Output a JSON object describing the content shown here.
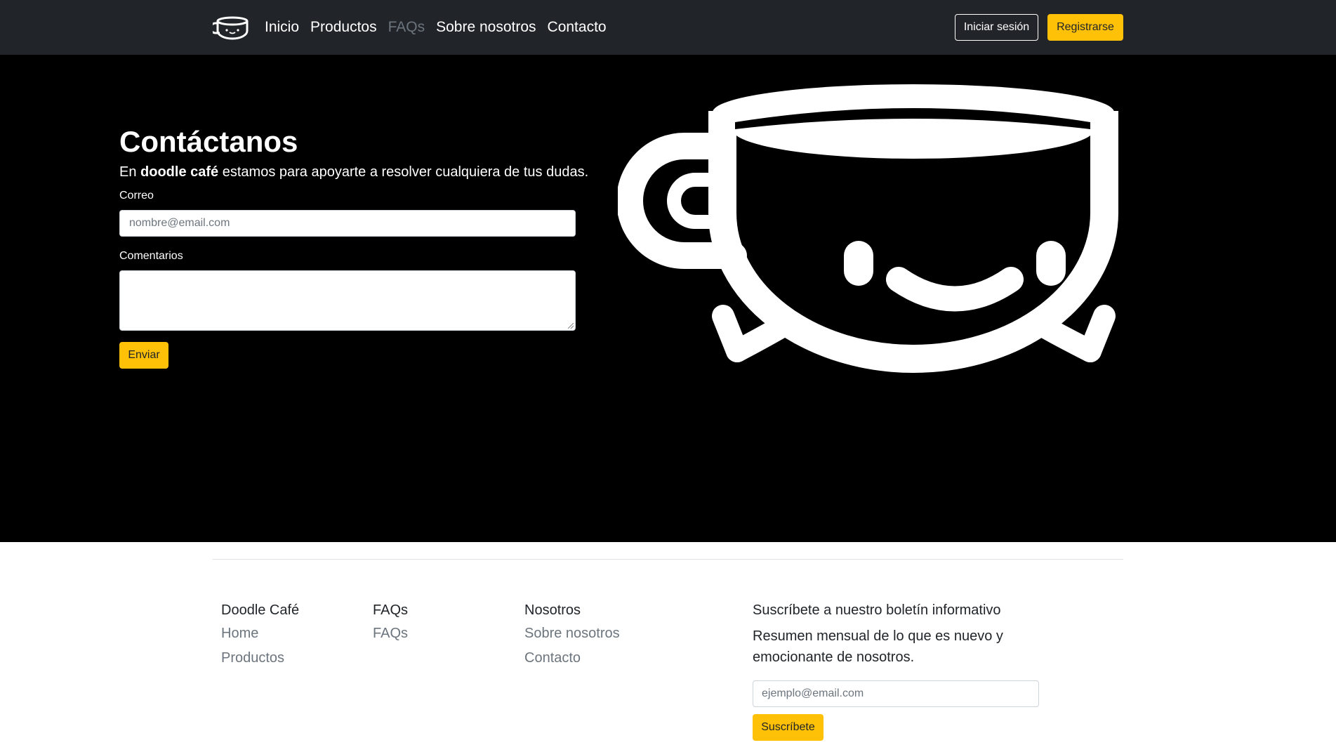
{
  "navbar": {
    "logo_icon": "coffee-cup-logo-icon",
    "links": [
      {
        "label": "Inicio",
        "active": false
      },
      {
        "label": "Productos",
        "active": false
      },
      {
        "label": "FAQs",
        "active": true
      },
      {
        "label": "Sobre nosotros",
        "active": false
      },
      {
        "label": "Contacto",
        "active": false
      }
    ],
    "login_label": "Iniciar sesión",
    "signup_label": "Registrarse"
  },
  "contact": {
    "title": "Contáctanos",
    "lead_prefix": "En ",
    "lead_brand": "doodle café",
    "lead_suffix": " estamos para apoyarte a resolver cualquiera de tus dudas.",
    "email_label": "Correo",
    "email_placeholder": "nombre@email.com",
    "comments_label": "Comentarios",
    "submit_label": "Enviar",
    "illustration_icon": "smiling-coffee-cup-icon"
  },
  "footer": {
    "columns": [
      {
        "heading": "Doodle Café",
        "links": [
          "Home",
          "Productos"
        ]
      },
      {
        "heading": "FAQs",
        "links": [
          "FAQs"
        ]
      },
      {
        "heading": "Nosotros",
        "links": [
          "Sobre nosotros",
          "Contacto"
        ]
      }
    ],
    "newsletter": {
      "heading": "Suscríbete a nuestro boletín informativo",
      "text": "Resumen mensual de lo que es nuevo y emocionante de nosotros.",
      "placeholder": "ejemplo@email.com",
      "button_label": "Suscríbete"
    }
  },
  "colors": {
    "navbar_bg": "#212529",
    "hero_bg": "#000000",
    "accent": "#ffc107",
    "muted": "#6c757d"
  }
}
